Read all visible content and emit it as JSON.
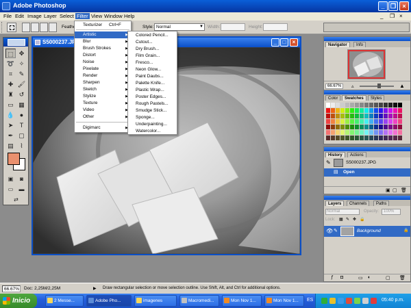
{
  "app": {
    "title": "Adobe Photoshop"
  },
  "menubar": [
    "File",
    "Edit",
    "Image",
    "Layer",
    "Select",
    "Filter",
    "View",
    "Window",
    "Help"
  ],
  "options": {
    "feather_label": "Feather:",
    "style_label": "Style:",
    "style_value": "Normal",
    "width_label": "Width:",
    "height_label": "Height:"
  },
  "filter_menu": {
    "last_filter": "Texturizer",
    "last_shortcut": "Ctrl+F",
    "items": [
      "Artistic",
      "Blur",
      "Brush Strokes",
      "Distort",
      "Noise",
      "Pixelate",
      "Render",
      "Sharpen",
      "Sketch",
      "Stylize",
      "Texture",
      "Video",
      "Other"
    ],
    "extra": "Digimarc"
  },
  "artistic_menu": [
    "Colored Pencil...",
    "Cutout...",
    "Dry Brush...",
    "Film Grain...",
    "Fresco...",
    "Neon Glow...",
    "Paint Daubs...",
    "Palette Knife...",
    "Plastic Wrap...",
    "Poster Edges...",
    "Rough Pastels...",
    "Smudge Stick...",
    "Sponge...",
    "Underpainting...",
    "Watercolor..."
  ],
  "document": {
    "title": "S5000237.JPG"
  },
  "navigator": {
    "tabs": [
      "Navigator",
      "Info"
    ],
    "zoom": "66.67%"
  },
  "swatches": {
    "tabs": [
      "Color",
      "Swatches",
      "Styles"
    ]
  },
  "history": {
    "tabs": [
      "History",
      "Actions"
    ],
    "snapshot": "S5000237.JPG",
    "step": "Open"
  },
  "layers": {
    "tabs": [
      "Layers",
      "Channels",
      "Paths"
    ],
    "blend": "Normal",
    "opacity_label": "Opacity:",
    "opacity": "100%",
    "lock_label": "Lock:",
    "layer_name": "Background"
  },
  "status": {
    "zoom": "66.67%",
    "doc": "Doc: 2,25M/2,25M",
    "hint": "Draw rectangular selection or move selection outline. Use Shift, Alt, and Ctrl for additional options."
  },
  "taskbar": {
    "start": "Inicio",
    "tasks": [
      "2 Messe...",
      "Adobe Pho...",
      "imagenes",
      "Macromedi...",
      "Mon Nov 1...",
      "Mon Nov 1..."
    ],
    "lang": "ES",
    "clock": "05:40 p.m."
  }
}
